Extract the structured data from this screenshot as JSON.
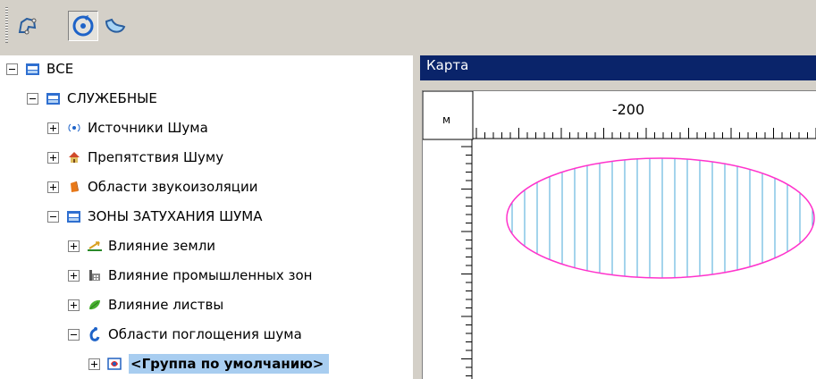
{
  "toolbar": {
    "buttons": [
      {
        "icon": "polygon-select-icon",
        "active": false
      },
      {
        "icon": "rotate-refresh-icon",
        "active": true
      },
      {
        "icon": "curved-shape-icon",
        "active": false
      }
    ]
  },
  "tree": {
    "items": [
      {
        "label": "ВСЕ",
        "level": 0,
        "expander": "minus",
        "icon": "folder-blue-icon"
      },
      {
        "label": "СЛУЖЕБНЫЕ",
        "level": 1,
        "expander": "minus",
        "icon": "folder-blue-icon"
      },
      {
        "label": "Источники Шума",
        "level": 2,
        "expander": "plus",
        "icon": "noise-source-icon"
      },
      {
        "label": "Препятствия Шуму",
        "level": 2,
        "expander": "plus",
        "icon": "house-icon"
      },
      {
        "label": "Области звукоизоляции",
        "level": 2,
        "expander": "plus",
        "icon": "orange-block-icon"
      },
      {
        "label": "ЗОНЫ ЗАТУХАНИЯ ШУМА",
        "level": 2,
        "expander": "minus",
        "icon": "folder-blue-icon"
      },
      {
        "label": "Влияние земли",
        "level": 3,
        "expander": "plus",
        "icon": "ground-icon"
      },
      {
        "label": "Влияние промышленных зон",
        "level": 3,
        "expander": "plus",
        "icon": "factory-icon"
      },
      {
        "label": "Влияние листвы",
        "level": 3,
        "expander": "plus",
        "icon": "leaf-icon"
      },
      {
        "label": "Области поглощения шума",
        "level": 3,
        "expander": "minus",
        "icon": "absorption-icon"
      },
      {
        "label": "<Группа по умолчанию>",
        "level": 4,
        "expander": "plus",
        "icon": "default-group-icon",
        "selected": true
      }
    ]
  },
  "map": {
    "title": "Карта",
    "unit": "м",
    "ruler_label": "-200",
    "ellipse_stroke": "#ff33cc",
    "hatch_color": "#4aa8d8"
  }
}
